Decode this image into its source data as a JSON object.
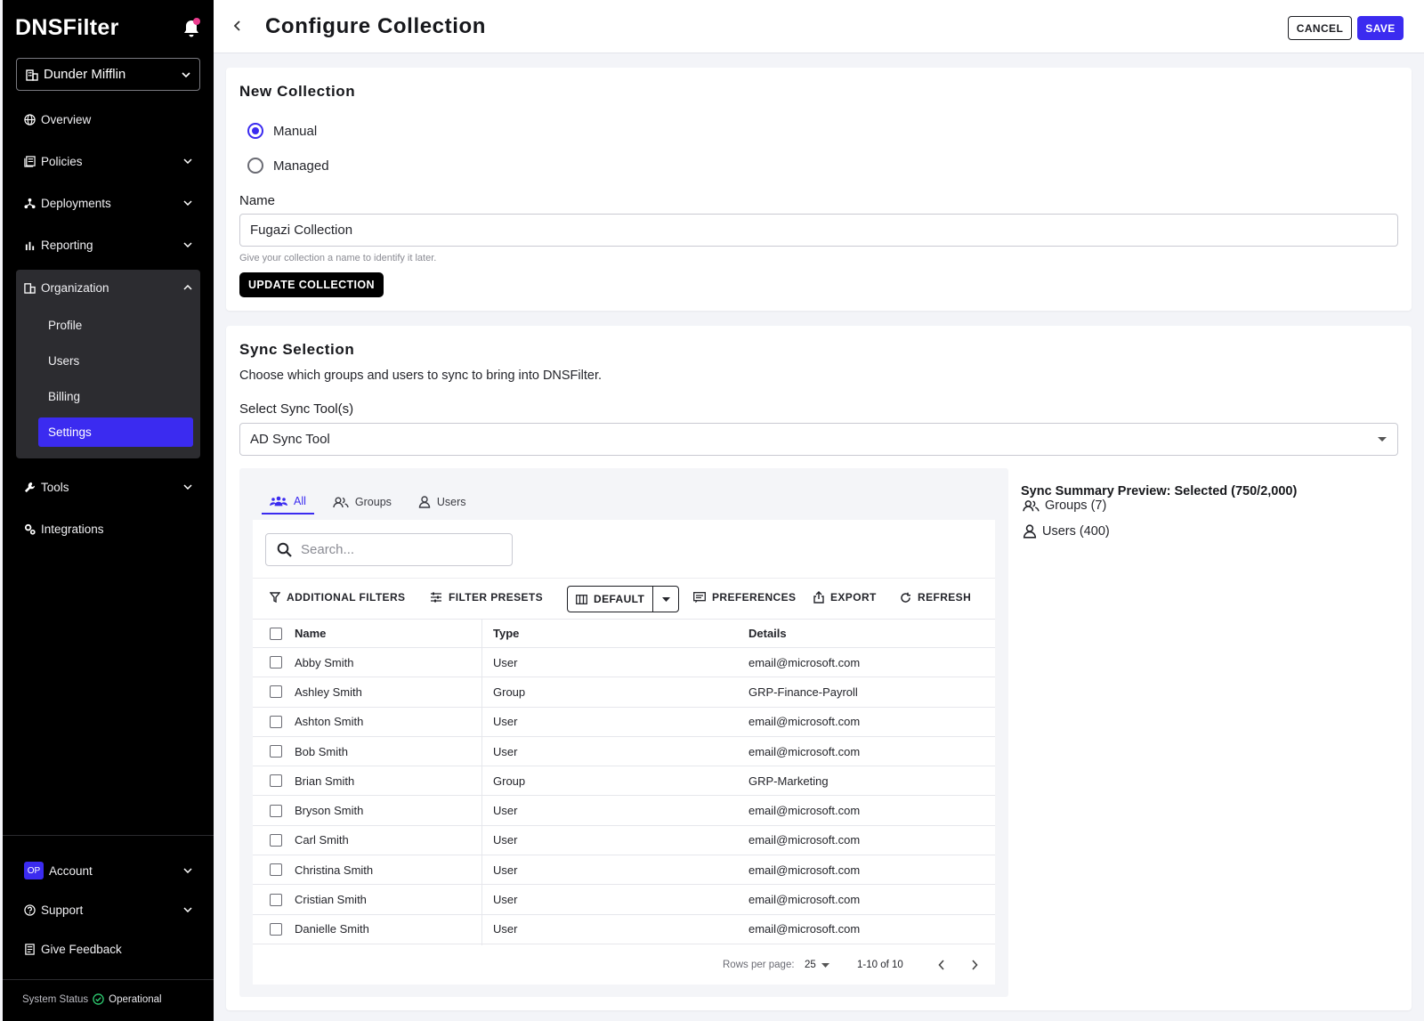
{
  "sidebar": {
    "logo": "DNSFilter",
    "org_name": "Dunder Mifflin",
    "items": [
      {
        "label": "Overview"
      },
      {
        "label": "Policies"
      },
      {
        "label": "Deployments"
      },
      {
        "label": "Reporting"
      },
      {
        "label": "Organization"
      },
      {
        "label": "Tools"
      },
      {
        "label": "Integrations"
      }
    ],
    "org_sub": [
      "Profile",
      "Users",
      "Billing",
      "Settings"
    ],
    "account_badge": "OP",
    "account": "Account",
    "support": "Support",
    "feedback": "Give Feedback",
    "status_label": "System Status",
    "status_value": "Operational"
  },
  "header": {
    "title": "Configure Collection",
    "cancel": "CANCEL",
    "save": "SAVE"
  },
  "new_collection": {
    "title": "New Collection",
    "radio_manual": "Manual",
    "radio_managed": "Managed",
    "name_label": "Name",
    "name_value": "Fugazi Collection",
    "helper": "Give your collection a name to identify it later.",
    "update_button": "UPDATE COLLECTION"
  },
  "sync": {
    "title": "Sync Selection",
    "description": "Choose which groups and users to sync to bring into DNSFilter.",
    "tool_label": "Select Sync Tool(s)",
    "tool_value": "AD Sync Tool",
    "tabs": [
      "All",
      "Groups",
      "Users"
    ],
    "search_placeholder": "Search...",
    "toolbar": {
      "filters": "ADDITIONAL FILTERS",
      "presets": "FILTER PRESETS",
      "default": "DEFAULT",
      "preferences": "PREFERENCES",
      "export": "EXPORT",
      "refresh": "REFRESH"
    },
    "columns": [
      "Name",
      "Type",
      "Details"
    ],
    "rows": [
      {
        "name": "Abby Smith",
        "type": "User",
        "details": "email@microsoft.com"
      },
      {
        "name": "Ashley Smith",
        "type": "Group",
        "details": "GRP-Finance-Payroll"
      },
      {
        "name": "Ashton Smith",
        "type": "User",
        "details": "email@microsoft.com"
      },
      {
        "name": "Bob Smith",
        "type": "User",
        "details": "email@microsoft.com"
      },
      {
        "name": "Brian Smith",
        "type": "Group",
        "details": "GRP-Marketing"
      },
      {
        "name": "Bryson Smith",
        "type": "User",
        "details": "email@microsoft.com"
      },
      {
        "name": "Carl Smith",
        "type": "User",
        "details": "email@microsoft.com"
      },
      {
        "name": "Christina Smith",
        "type": "User",
        "details": "email@microsoft.com"
      },
      {
        "name": "Cristian Smith",
        "type": "User",
        "details": "email@microsoft.com"
      },
      {
        "name": "Danielle Smith",
        "type": "User",
        "details": "email@microsoft.com"
      }
    ],
    "pager": {
      "rows_per_page_label": "Rows per page:",
      "rows_per_page": "25",
      "range": "1-10 of 10"
    },
    "summary": {
      "title": "Sync Summary Preview: Selected (750/2,000)",
      "groups": "Groups (7)",
      "users": "Users (400)"
    }
  },
  "colors": {
    "accent": "#3b2bf0",
    "sidebar_bg": "#000000",
    "status_ok": "#2ecc71"
  }
}
